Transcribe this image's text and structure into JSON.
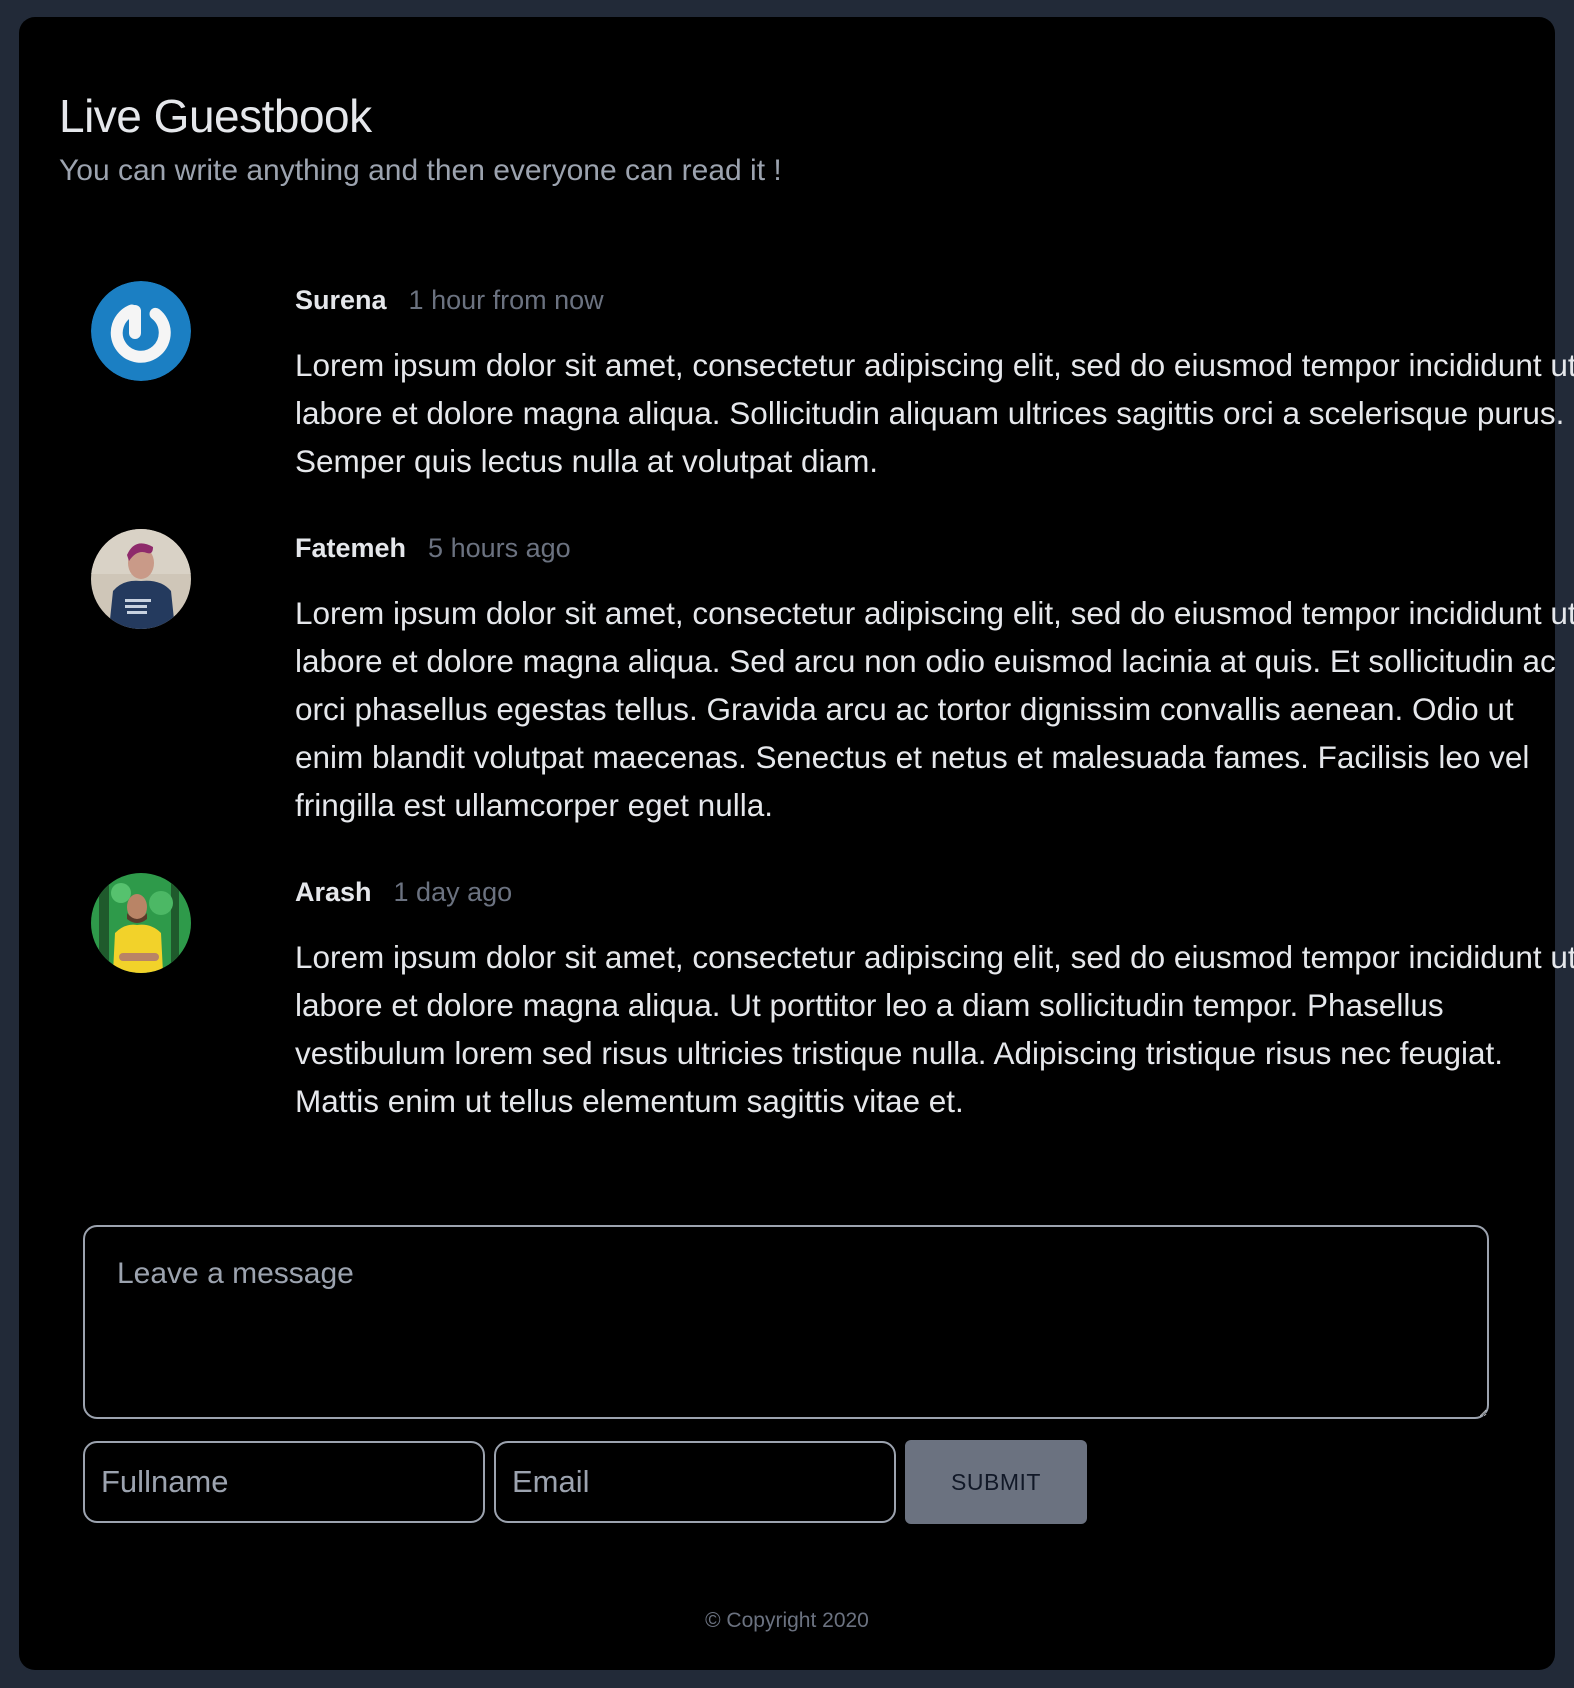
{
  "header": {
    "title": "Live Guestbook",
    "subtitle": "You can write anything and then everyone can read it !"
  },
  "comments": [
    {
      "name": "Surena",
      "time": "1 hour from now",
      "avatar": "power-logo-avatar",
      "body": "Lorem ipsum dolor sit amet, consectetur adipiscing elit, sed do eiusmod tempor incididunt ut labore et dolore magna aliqua. Sollicitudin aliquam ultrices sagittis orci a scelerisque purus. Semper quis lectus nulla at volutpat diam."
    },
    {
      "name": "Fatemeh",
      "time": "5 hours ago",
      "avatar": "photo-avatar",
      "body": "Lorem ipsum dolor sit amet, consectetur adipiscing elit, sed do eiusmod tempor incididunt ut labore et dolore magna aliqua. Sed arcu non odio euismod lacinia at quis. Et sollicitudin ac orci phasellus egestas tellus. Gravida arcu ac tortor dignissim convallis aenean. Odio ut enim blandit volutpat maecenas. Senectus et netus et malesuada fames. Facilisis leo vel fringilla est ullamcorper eget nulla."
    },
    {
      "name": "Arash",
      "time": "1 day ago",
      "avatar": "photo-avatar",
      "body": "Lorem ipsum dolor sit amet, consectetur adipiscing elit, sed do eiusmod tempor incididunt ut labore et dolore magna aliqua. Ut porttitor leo a diam sollicitudin tempor. Phasellus vestibulum lorem sed risus ultricies tristique nulla. Adipiscing tristique risus nec feugiat. Mattis enim ut tellus elementum sagittis vitae et."
    }
  ],
  "form": {
    "message_placeholder": "Leave a message",
    "message_value": "",
    "fullname_placeholder": "Fullname",
    "fullname_value": "",
    "email_placeholder": "Email",
    "email_value": "",
    "submit_label": "SUBMIT"
  },
  "footer": {
    "copyright": "© Copyright 2020"
  },
  "colors": {
    "page_bg": "#222a38",
    "card_bg": "#000000",
    "avatar_blue": "#1b7fc3",
    "muted_text": "#6b7280",
    "button_bg": "#6b7280"
  }
}
